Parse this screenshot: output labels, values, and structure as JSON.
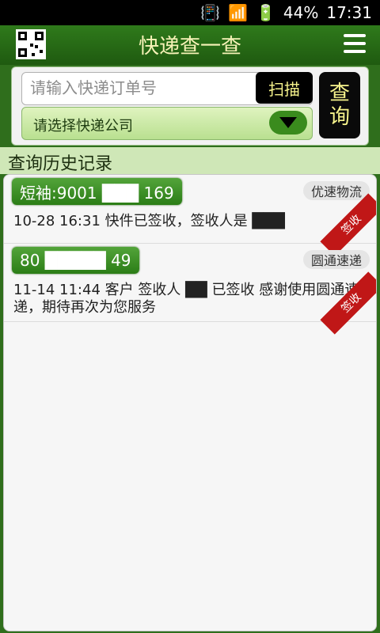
{
  "status_bar": {
    "battery_percent": "44%",
    "time": "17:31"
  },
  "app": {
    "title": "快递查一查",
    "qr_icon": "qr-code-icon",
    "menu_icon": "hamburger-menu-icon"
  },
  "search": {
    "placeholder": "请输入快递订单号",
    "scan_label": "扫描",
    "company_select_label": "请选择快递公司",
    "query_label_line1": "查",
    "query_label_line2": "询"
  },
  "history": {
    "title": "查询历史记录",
    "items": [
      {
        "order": "短袖:9001 ███ 169",
        "company": "优速物流",
        "message": "10-28 16:31 快件已签收，签收人是 ███",
        "stamp": "签收"
      },
      {
        "order": "80 █████ 49",
        "company": "圆通速递",
        "message": "11-14 11:44 客户 签收人 ██ 已签收 感谢使用圆通速递，期待再次为您服务",
        "stamp": "签收"
      }
    ]
  },
  "colors": {
    "appbar": "#2f7a1b",
    "accent_green": "#3a8b1d",
    "title_text": "#f6f2b7",
    "button_text": "#f7f48c",
    "stamp_red": "#c01717"
  }
}
